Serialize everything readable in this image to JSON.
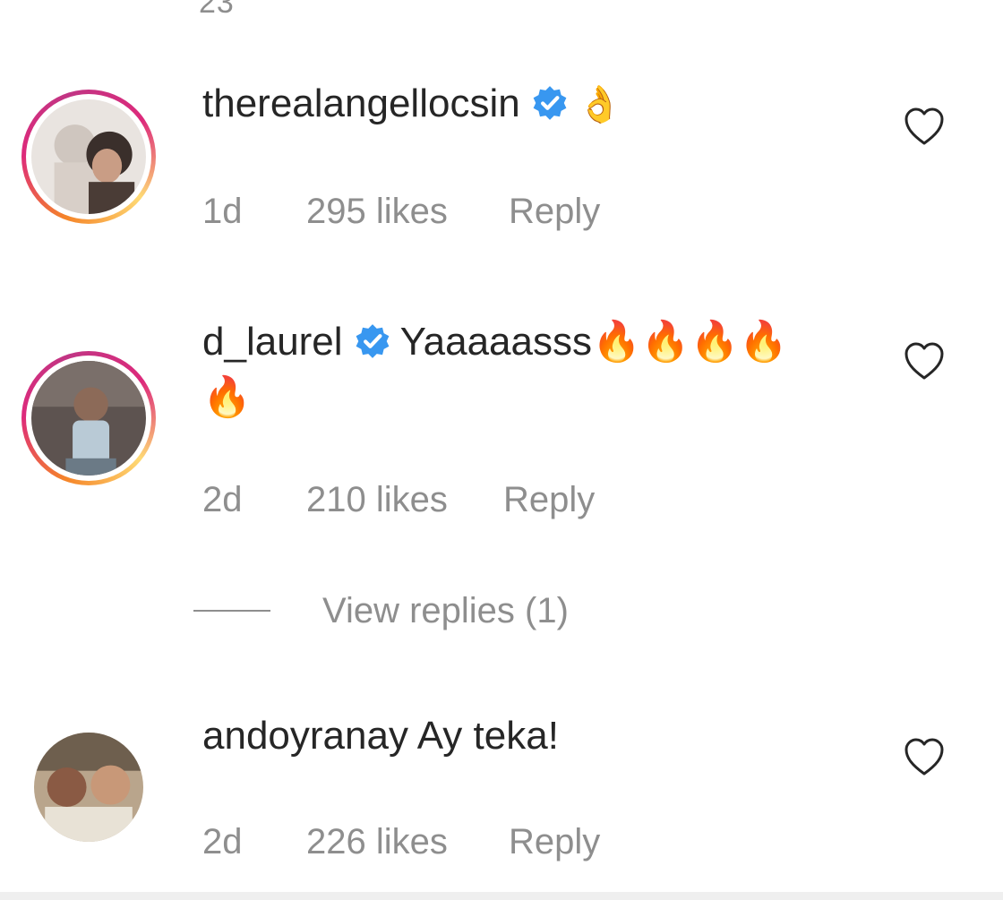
{
  "top_partial_text": "23",
  "comments": [
    {
      "username": "therealangellocsin",
      "verified": true,
      "text": "👌",
      "time": "1d",
      "likes": "295 likes",
      "reply": "Reply"
    },
    {
      "username": "d_laurel",
      "verified": true,
      "text": "Yaaaaasss🔥🔥🔥🔥",
      "text_line2": "🔥",
      "time": "2d",
      "likes": "210 likes",
      "reply": "Reply",
      "view_replies": "View replies (1)"
    },
    {
      "username": "andoyranay",
      "verified": false,
      "text": "Ay teka!",
      "time": "2d",
      "likes": "226 likes",
      "reply": "Reply"
    }
  ],
  "colors": {
    "text": "#262626",
    "secondary": "#8e8e8e",
    "verified_blue": "#3897f0",
    "story_ring_start": "#f58529",
    "story_ring_end": "#dd2a7b"
  },
  "icons": {
    "verified": "verified-badge-icon",
    "like": "heart-outline-icon"
  }
}
